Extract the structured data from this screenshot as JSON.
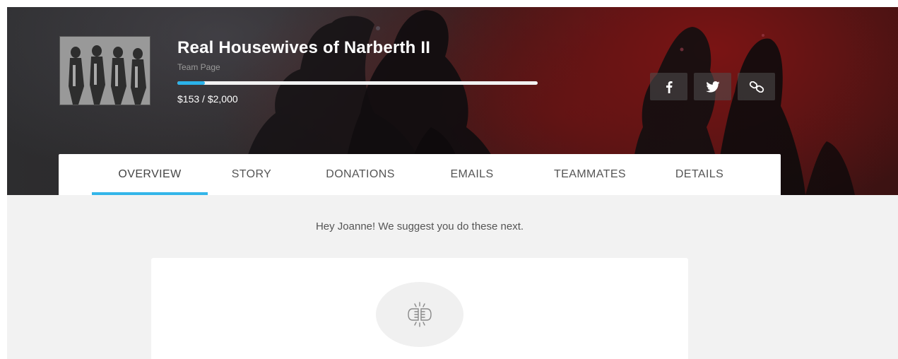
{
  "header": {
    "team_name": "Real Housewives of Narberth II",
    "page_type": "Team Page",
    "raised": "$153",
    "separator": " / ",
    "goal": "$2,000",
    "progress_fraction": 0.0765,
    "accent_color": "#33b5e9"
  },
  "share": [
    {
      "name": "facebook-share-button",
      "icon": "facebook-icon"
    },
    {
      "name": "twitter-share-button",
      "icon": "twitter-icon"
    },
    {
      "name": "copy-link-button",
      "icon": "link-icon"
    }
  ],
  "tabs": {
    "items": [
      {
        "label": "OVERVIEW",
        "active": true
      },
      {
        "label": "STORY",
        "active": false
      },
      {
        "label": "DONATIONS",
        "active": false
      },
      {
        "label": "EMAILS",
        "active": false
      },
      {
        "label": "TEAMMATES",
        "active": false
      },
      {
        "label": "DETAILS",
        "active": false
      }
    ]
  },
  "main": {
    "suggestion_text": "Hey Joanne! We suggest you do these next.",
    "card_icon": "fist-bump-icon"
  }
}
